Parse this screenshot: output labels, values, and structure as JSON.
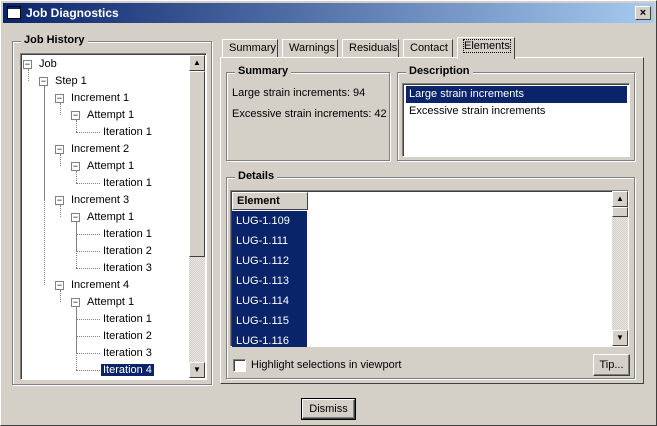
{
  "window": {
    "title": "Job Diagnostics",
    "close_label": "×"
  },
  "job_history": {
    "legend": "Job History",
    "tree": [
      {
        "label": "Job",
        "depth": 0,
        "expander": "−",
        "selected": false
      },
      {
        "label": "Step 1",
        "depth": 1,
        "expander": "−",
        "selected": false
      },
      {
        "label": "Increment 1",
        "depth": 2,
        "expander": "−",
        "selected": false
      },
      {
        "label": "Attempt 1",
        "depth": 3,
        "expander": "−",
        "selected": false
      },
      {
        "label": "Iteration 1",
        "depth": 4,
        "expander": null,
        "selected": false
      },
      {
        "label": "Increment 2",
        "depth": 2,
        "expander": "−",
        "selected": false
      },
      {
        "label": "Attempt 1",
        "depth": 3,
        "expander": "−",
        "selected": false
      },
      {
        "label": "Iteration 1",
        "depth": 4,
        "expander": null,
        "selected": false
      },
      {
        "label": "Increment 3",
        "depth": 2,
        "expander": "−",
        "selected": false
      },
      {
        "label": "Attempt 1",
        "depth": 3,
        "expander": "−",
        "selected": false
      },
      {
        "label": "Iteration 1",
        "depth": 4,
        "expander": null,
        "selected": false
      },
      {
        "label": "Iteration 2",
        "depth": 4,
        "expander": null,
        "selected": false
      },
      {
        "label": "Iteration 3",
        "depth": 4,
        "expander": null,
        "selected": false
      },
      {
        "label": "Increment 4",
        "depth": 2,
        "expander": "−",
        "selected": false
      },
      {
        "label": "Attempt 1",
        "depth": 3,
        "expander": "−",
        "selected": false
      },
      {
        "label": "Iteration 1",
        "depth": 4,
        "expander": null,
        "selected": false
      },
      {
        "label": "Iteration 2",
        "depth": 4,
        "expander": null,
        "selected": false
      },
      {
        "label": "Iteration 3",
        "depth": 4,
        "expander": null,
        "selected": false
      },
      {
        "label": "Iteration 4",
        "depth": 4,
        "expander": null,
        "selected": true
      }
    ]
  },
  "tabs": [
    {
      "label": "Summary",
      "active": false
    },
    {
      "label": "Warnings",
      "active": false
    },
    {
      "label": "Residuals",
      "active": false
    },
    {
      "label": "Contact",
      "active": false
    },
    {
      "label": "Elements",
      "active": true
    }
  ],
  "summary": {
    "legend": "Summary",
    "large_strain": "Large strain increments: 94",
    "excessive_strain": "Excessive strain increments: 42"
  },
  "description": {
    "legend": "Description",
    "items": [
      {
        "label": "Large strain increments",
        "selected": true
      },
      {
        "label": "Excessive strain increments",
        "selected": false
      }
    ]
  },
  "details": {
    "legend": "Details",
    "column_header": "Element",
    "rows": [
      "LUG-1.109",
      "LUG-1.111",
      "LUG-1.112",
      "LUG-1.113",
      "LUG-1.114",
      "LUG-1.115",
      "LUG-1.116"
    ],
    "highlight_label": "Highlight selections in viewport",
    "highlight_checked": false,
    "tip_label": "Tip..."
  },
  "footer": {
    "dismiss_label": "Dismiss"
  },
  "colors": {
    "selection": "#0a246a",
    "face": "#d4d0c8",
    "title_start": "#0a246a",
    "title_end": "#a6caf0"
  },
  "icons": {
    "window": "window-app-icon",
    "close": "close-icon",
    "expander": "tree-collapse-icon",
    "scroll_up": "arrow-up-icon",
    "scroll_down": "arrow-down-icon"
  }
}
